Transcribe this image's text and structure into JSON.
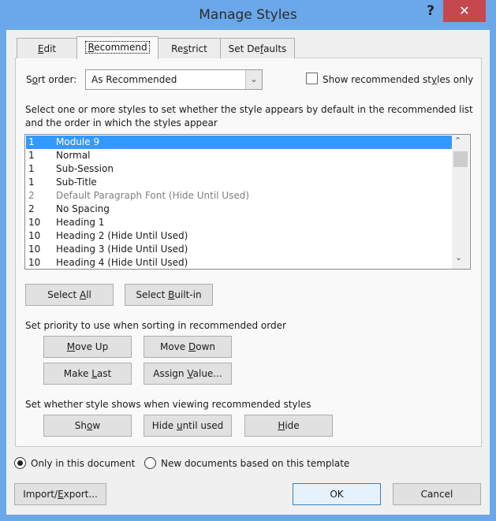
{
  "window": {
    "title": "Manage Styles",
    "help": "?",
    "close": "✕"
  },
  "tabs": [
    {
      "label": "Edit",
      "ul": 0
    },
    {
      "label": "Recommend",
      "ul": 0
    },
    {
      "label": "Restrict",
      "ul": 2
    },
    {
      "label": "Set Defaults",
      "ul": 6
    }
  ],
  "active_tab": "Recommend",
  "sort": {
    "label": "Sort order:",
    "ul": 1,
    "value": "As Recommended",
    "arrow": "⌄"
  },
  "show_recommended": {
    "label": "Show recommended styles only",
    "ul": 19,
    "checked": false
  },
  "instructions": [
    "Select one or more styles to set whether the style appears by default in the recommended list",
    "and the order in which the styles appear"
  ],
  "styles": [
    {
      "priority": "1",
      "name": "Module 9",
      "selected": true
    },
    {
      "priority": "1",
      "name": "Normal"
    },
    {
      "priority": "1",
      "name": "Sub-Session"
    },
    {
      "priority": "1",
      "name": "Sub-Title"
    },
    {
      "priority": "2",
      "name": "Default Paragraph Font  (Hide Until Used)",
      "dim": true
    },
    {
      "priority": "2",
      "name": "No Spacing"
    },
    {
      "priority": "10",
      "name": "Heading 1"
    },
    {
      "priority": "10",
      "name": "Heading 2  (Hide Until Used)"
    },
    {
      "priority": "10",
      "name": "Heading 3  (Hide Until Used)"
    },
    {
      "priority": "10",
      "name": "Heading 4  (Hide Until Used)"
    }
  ],
  "select_buttons": {
    "select_all": "Select All",
    "select_all_ul": 7,
    "select_builtin": "Select Built-in",
    "select_builtin_ul": 7
  },
  "priority": {
    "heading": "Set priority to use when sorting in recommended order",
    "move_up": "Move Up",
    "move_up_ul": 0,
    "move_down": "Move Down",
    "move_down_ul": 5,
    "make_last": "Make Last",
    "make_last_ul": 5,
    "assign": "Assign Value...",
    "assign_ul": 7
  },
  "visibility": {
    "heading": "Set whether style shows when viewing recommended styles",
    "show": "Show",
    "show_ul": 2,
    "hide_until": "Hide until used",
    "hide_until_ul": 5,
    "hide": "Hide",
    "hide_ul": 0
  },
  "scope": {
    "only_doc": "Only in this document",
    "new_docs": "New documents based on this template",
    "selected": "only_doc"
  },
  "footer": {
    "import_export": "Import/Export...",
    "import_ul": 7,
    "ok": "OK",
    "cancel": "Cancel"
  }
}
